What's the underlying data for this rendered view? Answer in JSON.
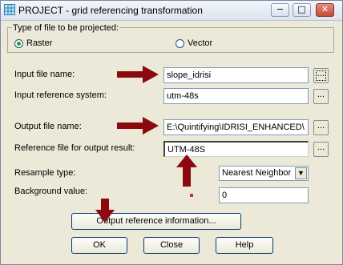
{
  "window": {
    "title": "PROJECT - grid referencing transformation",
    "controls": {
      "minimize": "−",
      "maximize": "□",
      "close": "✕"
    }
  },
  "file_type": {
    "legend": "Type of file to be projected:",
    "options": [
      {
        "label": "Raster",
        "checked": true
      },
      {
        "label": "Vector",
        "checked": false
      }
    ]
  },
  "fields": {
    "input_file": {
      "label": "Input file name:",
      "value": "slope_idrisi"
    },
    "input_ref": {
      "label": "Input reference system:",
      "value": "utm-48s"
    },
    "output_file": {
      "label": "Output file name:",
      "value": "E:\\Quintifying\\IDRISI_ENHANCED\\"
    },
    "ref_output": {
      "label": "Reference file for output result:",
      "value": "UTM-48S"
    },
    "resample": {
      "label": "Resample type:",
      "value": "Nearest Neighbor"
    },
    "background": {
      "label": "Background value:",
      "value": "0"
    }
  },
  "browse_label": "...",
  "buttons": {
    "output_ref_info": "Output reference information...",
    "ok": "OK",
    "close": "Close",
    "help": "Help"
  },
  "colors": {
    "annotation_arrow": "#8b0a0f"
  },
  "icons": {
    "app": "grid-app-icon",
    "dropdown": "chevron-down-icon",
    "annotation": "arrow-icon"
  }
}
